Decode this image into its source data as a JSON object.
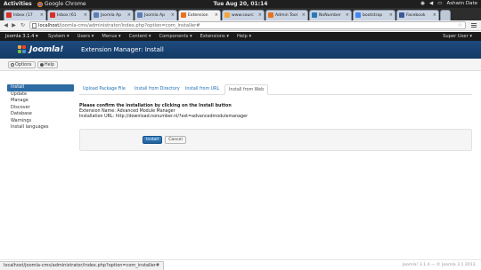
{
  "system_bar": {
    "activities": "Activities",
    "app_name": "Google Chrome",
    "clock": "Tue Aug 20, 01:14",
    "user": "Ashwin Date"
  },
  "browser": {
    "tabs": [
      {
        "label": "Inbox (17",
        "favicon_color": "#d93025",
        "active": false
      },
      {
        "label": "Inbox (61",
        "favicon_color": "#d93025",
        "active": false
      },
      {
        "label": "Joomla Ap",
        "favicon_color": "#5b7fb4",
        "active": false
      },
      {
        "label": "Joomla Ap",
        "favicon_color": "#5b7fb4",
        "active": false
      },
      {
        "label": "Extension",
        "favicon_color": "#e8731f",
        "active": true
      },
      {
        "label": "www.sourc",
        "favicon_color": "#f3a43b",
        "active": false
      },
      {
        "label": "Admin Tool",
        "favicon_color": "#e8731f",
        "active": false
      },
      {
        "label": "NoNumber",
        "favicon_color": "#2a7ab8",
        "active": false
      },
      {
        "label": "bootstrap",
        "favicon_color": "#4285f4",
        "active": false
      },
      {
        "label": "Facebook",
        "favicon_color": "#3b5998",
        "active": false
      }
    ],
    "url_host": "localhost",
    "url_rest": "/joomla-cms/administrator/index.php?option=com_installer#"
  },
  "joomla_menu": {
    "brand": "Joomla 3.1.4 ▾",
    "items": [
      "System ▾",
      "Users ▾",
      "Menus ▾",
      "Content ▾",
      "Components ▾",
      "Extensions ▾",
      "Help ▾"
    ],
    "user": "Super User ▾"
  },
  "header": {
    "logo_text": "Joomla!",
    "page_title": "Extension Manager: Install"
  },
  "toolbar": {
    "options_label": "Options",
    "help_label": "Help"
  },
  "sidebar": {
    "items": [
      "Install",
      "Update",
      "Manage",
      "Discover",
      "Database",
      "Warnings",
      "Install languages"
    ]
  },
  "main": {
    "tabs": [
      "Upload Package File",
      "Install from Directory",
      "Install from URL",
      "Install from Web"
    ],
    "active_tab": 3,
    "confirm_heading": "Please confirm the installation by clicking on the Install button",
    "extension_name": "Extension Name:  Advanced Module Manager",
    "installation_url": "Installation URL:  http://download.nonumber.nl/?ext=advancedmodulemanager",
    "install_label": "Install",
    "cancel_label": "Cancel"
  },
  "statusbar": {
    "text": "localhost/joomla-cms/administrator/index.php?option=com_installer#"
  },
  "footer": {
    "text": "Joomla! 3.1.4  —  © Joomla 3.1 2013"
  }
}
